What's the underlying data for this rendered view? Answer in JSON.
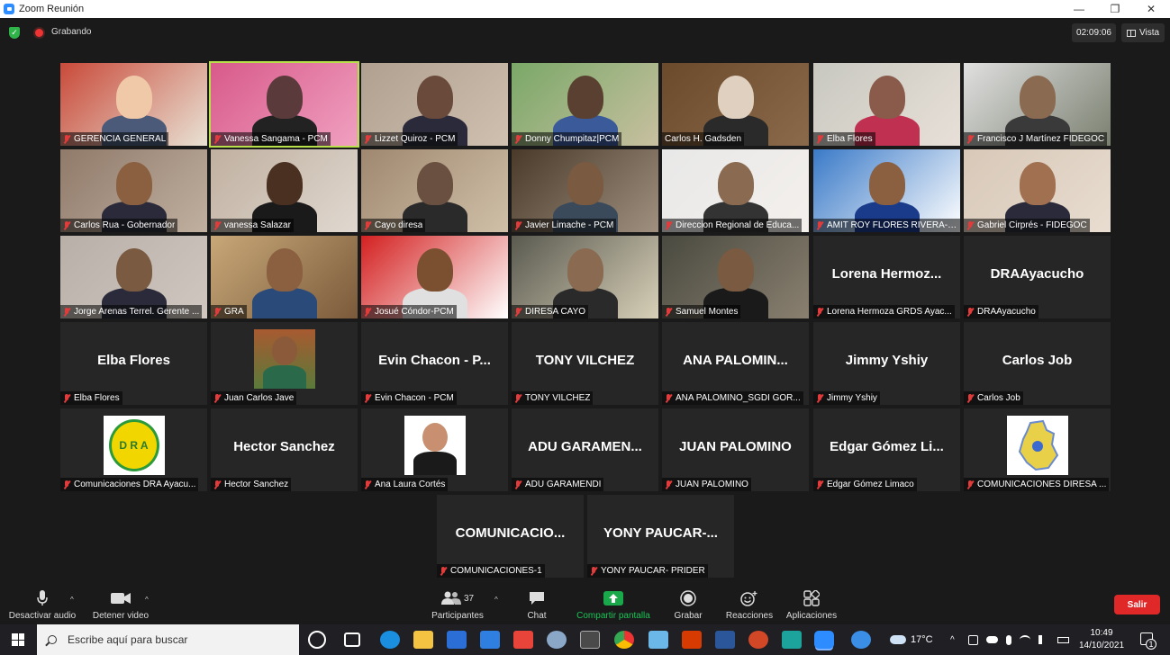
{
  "window": {
    "title": "Zoom Reunión"
  },
  "topbar": {
    "recording_label": "Grabando",
    "timer": "02:09:06",
    "view_label": "Vista"
  },
  "tiles": [
    {
      "name": "GERENCIA GENERAL",
      "big": "",
      "video": true
    },
    {
      "name": "Vanessa Sangama - PCM",
      "big": "",
      "video": true
    },
    {
      "name": "Lizzet Quiroz - PCM",
      "big": "",
      "video": true
    },
    {
      "name": "Donny Chumpitaz|PCM",
      "big": "",
      "video": true
    },
    {
      "name": "Carlos H. Gadsden",
      "big": "",
      "video": true
    },
    {
      "name": "Elba Flores",
      "big": "",
      "video": true
    },
    {
      "name": "Francisco J Martínez FIDEGOC",
      "big": "",
      "video": true
    },
    {
      "name": "Carlos Rua - Gobernador",
      "big": "",
      "video": true
    },
    {
      "name": "vanessa Salazar",
      "big": "",
      "video": true
    },
    {
      "name": "Cayo diresa",
      "big": "",
      "video": true
    },
    {
      "name": "Javier Limache - PCM",
      "big": "",
      "video": true
    },
    {
      "name": "Direccion Regional de Educa...",
      "big": "",
      "video": true
    },
    {
      "name": "AMIT ROY FLORES RIVERA- ...",
      "big": "",
      "video": true
    },
    {
      "name": "Gabriel Cirprés - FIDEGOC",
      "big": "",
      "video": true
    },
    {
      "name": "Jorge Arenas Terrel. Gerente ...",
      "big": "",
      "video": true
    },
    {
      "name": "GRA",
      "big": "",
      "video": true
    },
    {
      "name": "Josué Cóndor-PCM",
      "big": "",
      "video": true
    },
    {
      "name": "DIRESA CAYO",
      "big": "",
      "video": true
    },
    {
      "name": "Samuel Montes",
      "big": "",
      "video": true
    },
    {
      "name": "Lorena Hermoza GRDS Ayac...",
      "big": "Lorena Hermoz...",
      "video": false
    },
    {
      "name": "DRAAyacucho",
      "big": "DRAAyacucho",
      "video": false
    },
    {
      "name": "Elba Flores",
      "big": "Elba Flores",
      "video": false
    },
    {
      "name": "Juan Carlos Jave",
      "big": "",
      "video": false,
      "photo": true
    },
    {
      "name": "Evin Chacon - PCM",
      "big": "Evin Chacon - P...",
      "video": false
    },
    {
      "name": "TONY VILCHEZ",
      "big": "TONY VILCHEZ",
      "video": false
    },
    {
      "name": "ANA PALOMINO_SGDI GOR...",
      "big": "ANA PALOMIN...",
      "video": false
    },
    {
      "name": "Jimmy Yshiy",
      "big": "Jimmy Yshiy",
      "video": false
    },
    {
      "name": "Carlos Job",
      "big": "Carlos Job",
      "video": false
    },
    {
      "name": "Comunicaciones DRA Ayacu...",
      "big": "",
      "video": false,
      "logo": "dra"
    },
    {
      "name": "Hector Sanchez",
      "big": "Hector Sanchez",
      "video": false
    },
    {
      "name": "Ana Laura Cortés",
      "big": "",
      "video": false,
      "photo": true
    },
    {
      "name": "ADU GARAMENDI",
      "big": "ADU GARAMEN...",
      "video": false
    },
    {
      "name": "JUAN PALOMINO",
      "big": "JUAN PALOMINO",
      "video": false
    },
    {
      "name": "Edgar Gómez Limaco",
      "big": "Edgar Gómez Li...",
      "video": false
    },
    {
      "name": "COMUNICACIONES DIRESA ...",
      "big": "",
      "video": false,
      "logo": "map"
    },
    {
      "name": "COMUNICACIONES-1",
      "big": "COMUNICACIO...",
      "video": false
    },
    {
      "name": "YONY PAUCAR- PRIDER",
      "big": "YONY PAUCAR-...",
      "video": false
    }
  ],
  "toolbar": {
    "mute_label": "Desactivar audio",
    "video_label": "Detener video",
    "participants_label": "Participantes",
    "participants_count": "37",
    "chat_label": "Chat",
    "share_label": "Compartir pantalla",
    "record_label": "Grabar",
    "reactions_label": "Reacciones",
    "apps_label": "Aplicaciones",
    "leave_label": "Salir",
    "share_color": "#19a84a",
    "leave_color": "#e02828"
  },
  "logo_text": {
    "dra": "D R A"
  },
  "taskbar": {
    "search_placeholder": "Escribe aquí para buscar",
    "weather": "17°C",
    "time": "10:49",
    "date": "14/10/2021",
    "notifications": "1"
  }
}
